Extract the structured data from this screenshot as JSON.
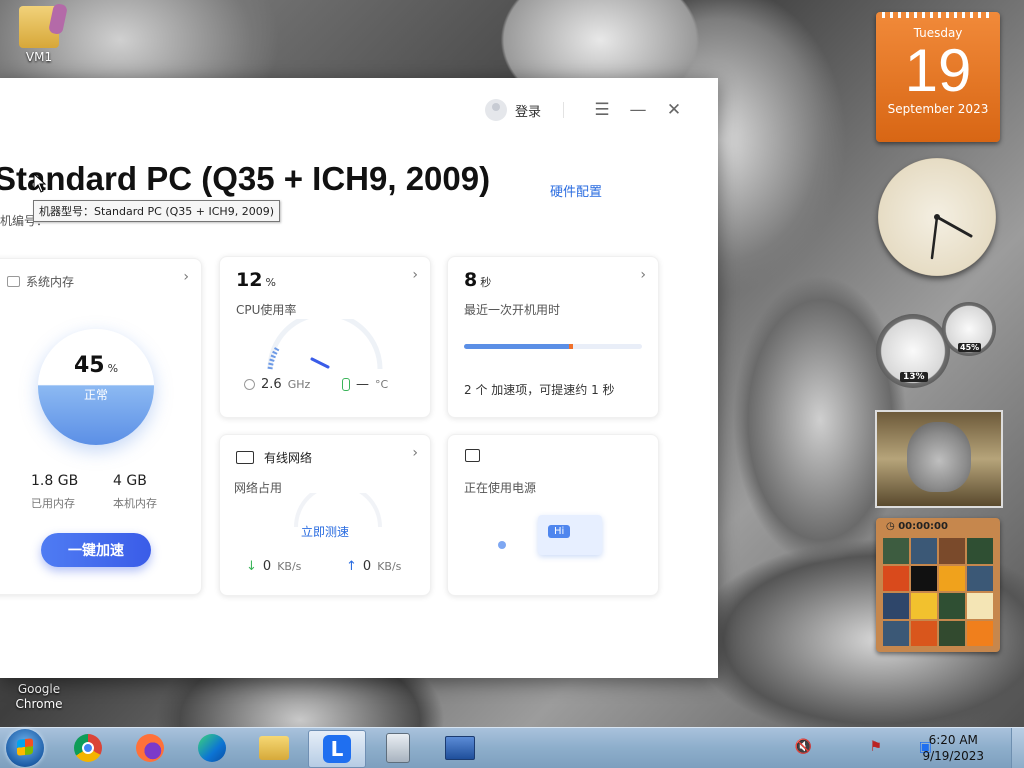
{
  "desktop": {
    "icons": [
      {
        "label": "VM1"
      },
      {
        "label": "Google\nChrome",
        "line1": "Google",
        "line2": "Chrome"
      }
    ]
  },
  "window": {
    "login_label": "登录",
    "menu_icon": "menu-icon",
    "min_icon": "minimize-icon",
    "close_icon": "close-icon",
    "model_title": "Standard PC (Q35 + ICH9, 2009)",
    "hardware_link": "硬件配置",
    "machine_id_prefix": "机编号：",
    "tooltip": "机器型号：Standard PC (Q35 + ICH9, 2009)"
  },
  "memory_card": {
    "label": "系统内存",
    "percent": "45",
    "percent_unit": "%",
    "status": "正常",
    "used_value": "1.8 GB",
    "used_label": "已用内存",
    "total_value": "4 GB",
    "total_label": "本机内存",
    "boost_button": "一键加速"
  },
  "cpu_card": {
    "value": "12",
    "unit": "%",
    "label": "CPU使用率",
    "freq_value": "2.6",
    "freq_unit": "GHz",
    "temp_value": "—",
    "temp_unit": "°C"
  },
  "boot_card": {
    "value": "8",
    "unit": "秒",
    "label": "最近一次开机用时",
    "progress": 0.6,
    "tip": "2 个 加速项，可提速约 1 秒"
  },
  "network_card": {
    "title": "有线网络",
    "label": "网络占用",
    "speedtest": "立即测速",
    "down_value": "0",
    "down_unit": "KB/s",
    "up_value": "0",
    "up_unit": "KB/s"
  },
  "power_card": {
    "label": "正在使用电源",
    "hi": "Hi"
  },
  "gadgets": {
    "calendar": {
      "weekday": "Tuesday",
      "day": "19",
      "month_year": "September 2023"
    },
    "cpu_meter": {
      "cpu": "13%",
      "mem": "45%"
    },
    "puzzle_time": "00:00:00"
  },
  "taskbar": {
    "time": "6:20 AM",
    "date": "9/19/2023"
  },
  "colors": {
    "accent": "#3a5ce8",
    "link": "#2a6ce0",
    "progress_fill": "#5b8fe6",
    "progress_marker": "#f0712c"
  }
}
